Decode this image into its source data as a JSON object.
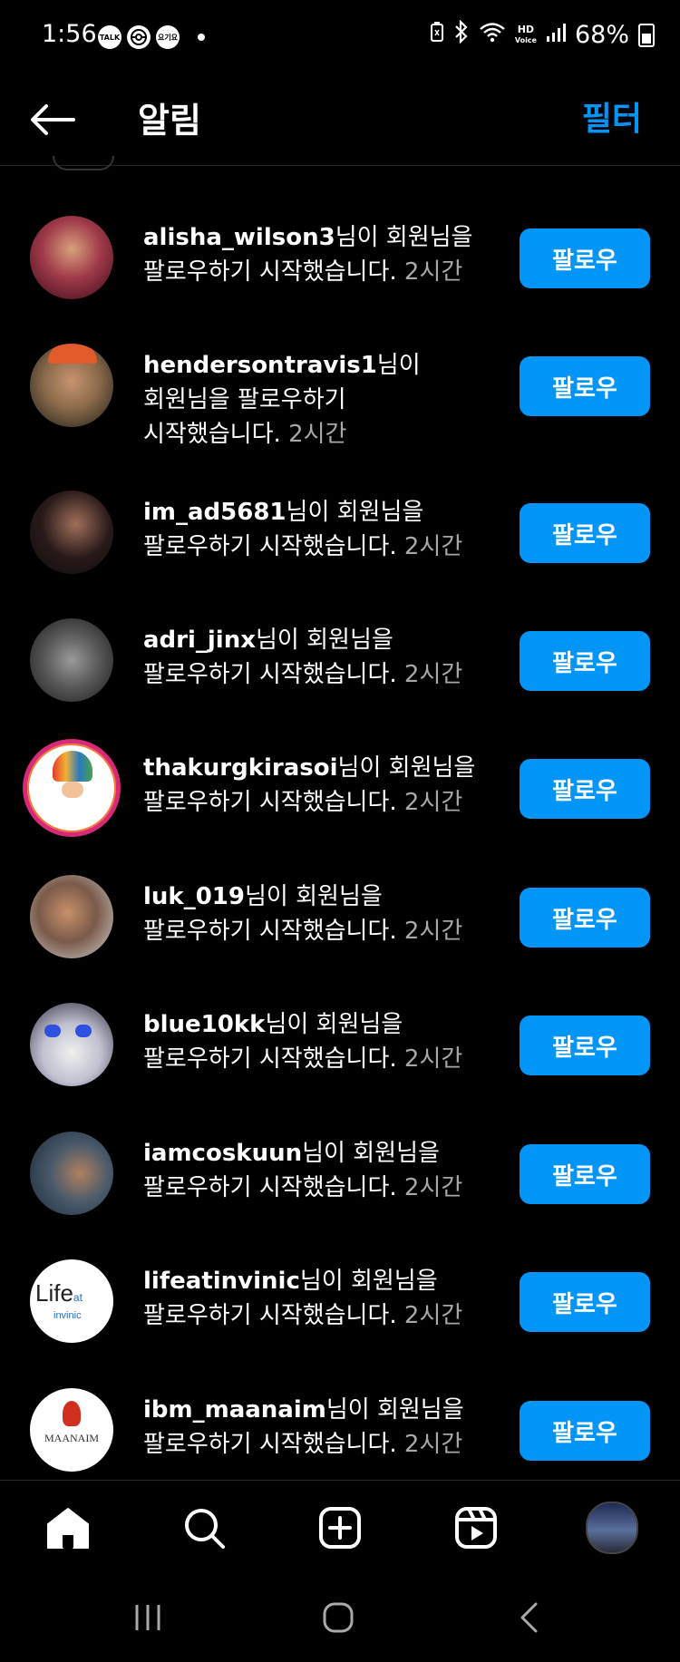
{
  "status_bar": {
    "time": "1:56",
    "left_icons": [
      "TALK",
      "pokeball",
      "요기요"
    ],
    "battery": "68%",
    "hd_label": "HD",
    "voice_label": "Voice"
  },
  "header": {
    "title": "알림",
    "filter_label": "필터"
  },
  "notifications": [
    {
      "username": "alisha_wilson3",
      "line1_rest": "님이 회원님을",
      "line2": "팔로우하기 시작했습니다.",
      "line3": "",
      "time": "2시간",
      "button": "팔로우"
    },
    {
      "username": "hendersontravis1",
      "line1_rest": "님이",
      "line2": "회원님을 팔로우하기",
      "line3": "시작했습니다.",
      "time": "2시간",
      "button": "팔로우"
    },
    {
      "username": "im_ad5681",
      "line1_rest": "님이 회원님을",
      "line2": "팔로우하기 시작했습니다.",
      "line3": "",
      "time": "2시간",
      "button": "팔로우"
    },
    {
      "username": "adri_jinx",
      "line1_rest": "님이 회원님을",
      "line2": "팔로우하기 시작했습니다.",
      "line3": "",
      "time": "2시간",
      "button": "팔로우"
    },
    {
      "username": "thakurgkirasoi",
      "line1_rest": "님이 회원님을",
      "line2": "팔로우하기 시작했습니다.",
      "line3": "",
      "time": "2시간",
      "button": "팔로우"
    },
    {
      "username": "luk_019",
      "line1_rest": "님이 회원님을",
      "line2": "팔로우하기 시작했습니다.",
      "line3": "",
      "time": "2시간",
      "button": "팔로우"
    },
    {
      "username": "blue10kk",
      "line1_rest": "님이 회원님을",
      "line2": "팔로우하기 시작했습니다.",
      "line3": "",
      "time": "2시간",
      "button": "팔로우"
    },
    {
      "username": "iamcoskuun",
      "line1_rest": "님이 회원님을",
      "line2": "팔로우하기 시작했습니다.",
      "line3": "",
      "time": "2시간",
      "button": "팔로우"
    },
    {
      "username": "lifeatinvinic",
      "line1_rest": "님이 회원님을",
      "line2": "팔로우하기 시작했습니다.",
      "line3": "",
      "time": "2시간",
      "button": "팔로우"
    },
    {
      "username": "ibm_maanaim",
      "line1_rest": "님이 회원님을",
      "line2": "팔로우하기 시작했습니다.",
      "line3": "",
      "time": "2시간",
      "button": "팔로우"
    }
  ],
  "avatar_logos": {
    "lifeatinvinic": {
      "line1": "Life",
      "small": "at",
      "line2": "invinic"
    },
    "ibm_maanaim": {
      "text": "MAANAIM"
    }
  },
  "colors": {
    "accent": "#0095f6",
    "background": "#000000",
    "secondary_text": "#a8a8a8"
  },
  "bottom_nav": [
    "home-icon",
    "search-icon",
    "create-icon",
    "reels-icon",
    "profile-avatar"
  ],
  "system_nav": [
    "recents-icon",
    "home-circle-icon",
    "back-chevron-icon"
  ]
}
